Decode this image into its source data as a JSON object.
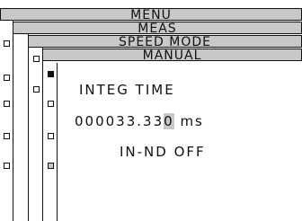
{
  "menu": {
    "level1": "MENU",
    "level2": "MEAS",
    "level3": "SPEED  MODE",
    "level4": "MANUAL"
  },
  "content": {
    "integ_label": "INTEG TIME",
    "value_main": "000033.33",
    "value_cursor_digit": "0",
    "value_unit": " ms",
    "nd_status": "IN-ND OFF"
  },
  "colors": {
    "header_bg": "#c8c8c8",
    "highlight": "#c8c8c8",
    "ink": "#111111"
  }
}
